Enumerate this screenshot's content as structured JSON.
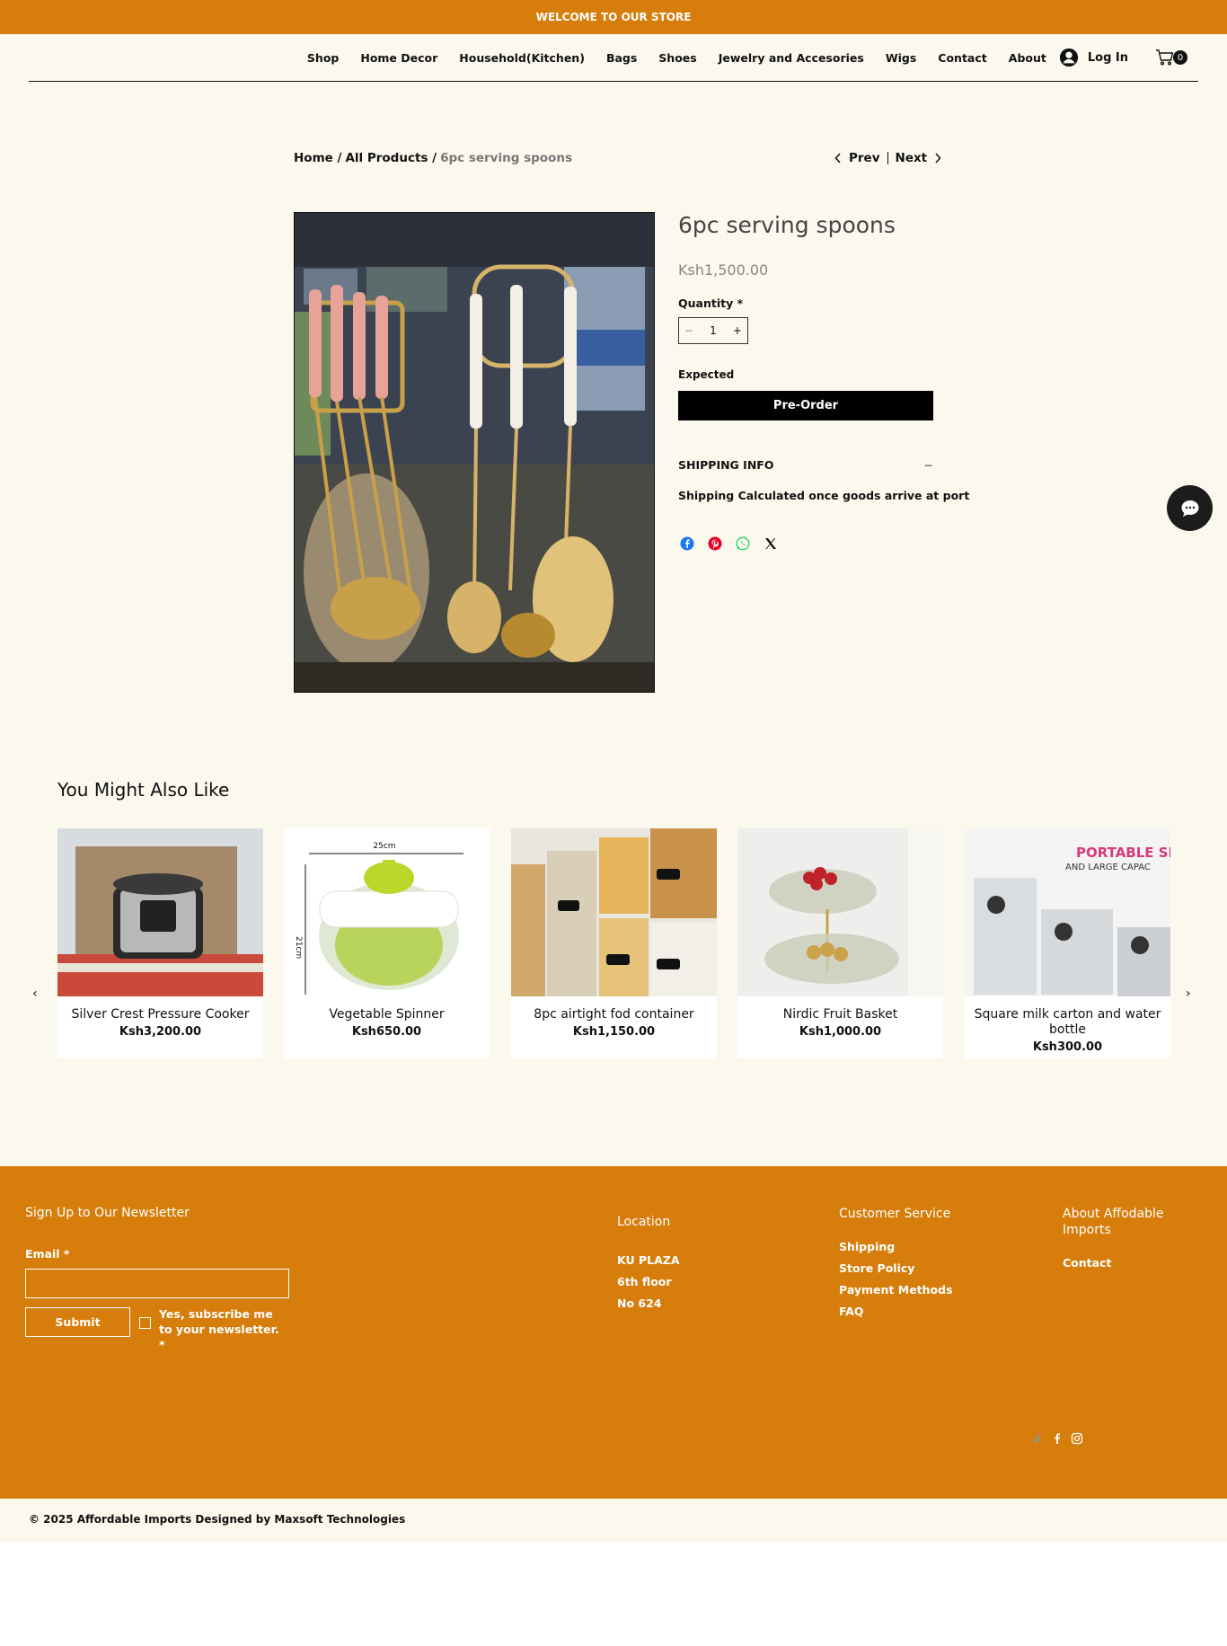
{
  "topbar": {
    "text": "WELCOME TO OUR STORE"
  },
  "nav": {
    "items": [
      "Shop",
      "Home Decor",
      "Household(Kitchen)",
      "Bags",
      "Shoes",
      "Jewelry and Accesories",
      "Wigs",
      "Contact",
      "About"
    ],
    "login": "Log In",
    "cart_count": "0"
  },
  "breadcrumb": {
    "home": "Home /",
    "all": "All Products /",
    "current": "6pc serving spoons"
  },
  "pager": {
    "prev": "Prev",
    "next": "Next"
  },
  "product": {
    "title": "6pc serving spoons",
    "price": "Ksh1,500.00",
    "quantity_label": "Quantity *",
    "quantity": "1",
    "minus": "−",
    "plus": "+",
    "expected_label": "Expected",
    "preorder": "Pre-Order",
    "shipping_head": "SHIPPING INFO",
    "shipping_toggle": "−",
    "shipping_text": "Shipping Calculated once goods arrive at port"
  },
  "also": {
    "title": "You Might Also Like",
    "prev_arrow": "‹",
    "next_arrow": "›",
    "products": [
      {
        "name": "Silver Crest Pressure Cooker",
        "price": "Ksh3,200.00"
      },
      {
        "name": "Vegetable Spinner",
        "price": "Ksh650.00"
      },
      {
        "name": "8pc airtight fod container",
        "price": "Ksh1,150.00"
      },
      {
        "name": "Nirdic Fruit Basket",
        "price": "Ksh1,000.00"
      },
      {
        "name": "Square milk carton and water bottle",
        "price": "Ksh300.00"
      }
    ],
    "spinner_dim_w": "25cm",
    "spinner_dim_h": "21cm",
    "carton_head": "PORTABLE SI",
    "carton_sub": "AND LARGE CAPAC"
  },
  "footer": {
    "newsletter": "Sign Up to Our Newsletter",
    "email_label": "Email *",
    "submit": "Submit",
    "subscribe": "Yes, subscribe me to your newsletter. *",
    "location_head": "Location",
    "location": [
      "KU PLAZA",
      "6th floor",
      "No 624"
    ],
    "service_head": "Customer Service",
    "service": [
      "Shipping",
      "Store Policy",
      "Payment Methods",
      "FAQ"
    ],
    "about_head": "About Affodable Imports",
    "about": [
      "Contact"
    ]
  },
  "copyright": "© 2025 Affordable Imports Designed by Maxsoft Technologies",
  "colors": {
    "brand": "#d67d0b",
    "background": "#fbf8ee",
    "button": "#000000"
  }
}
